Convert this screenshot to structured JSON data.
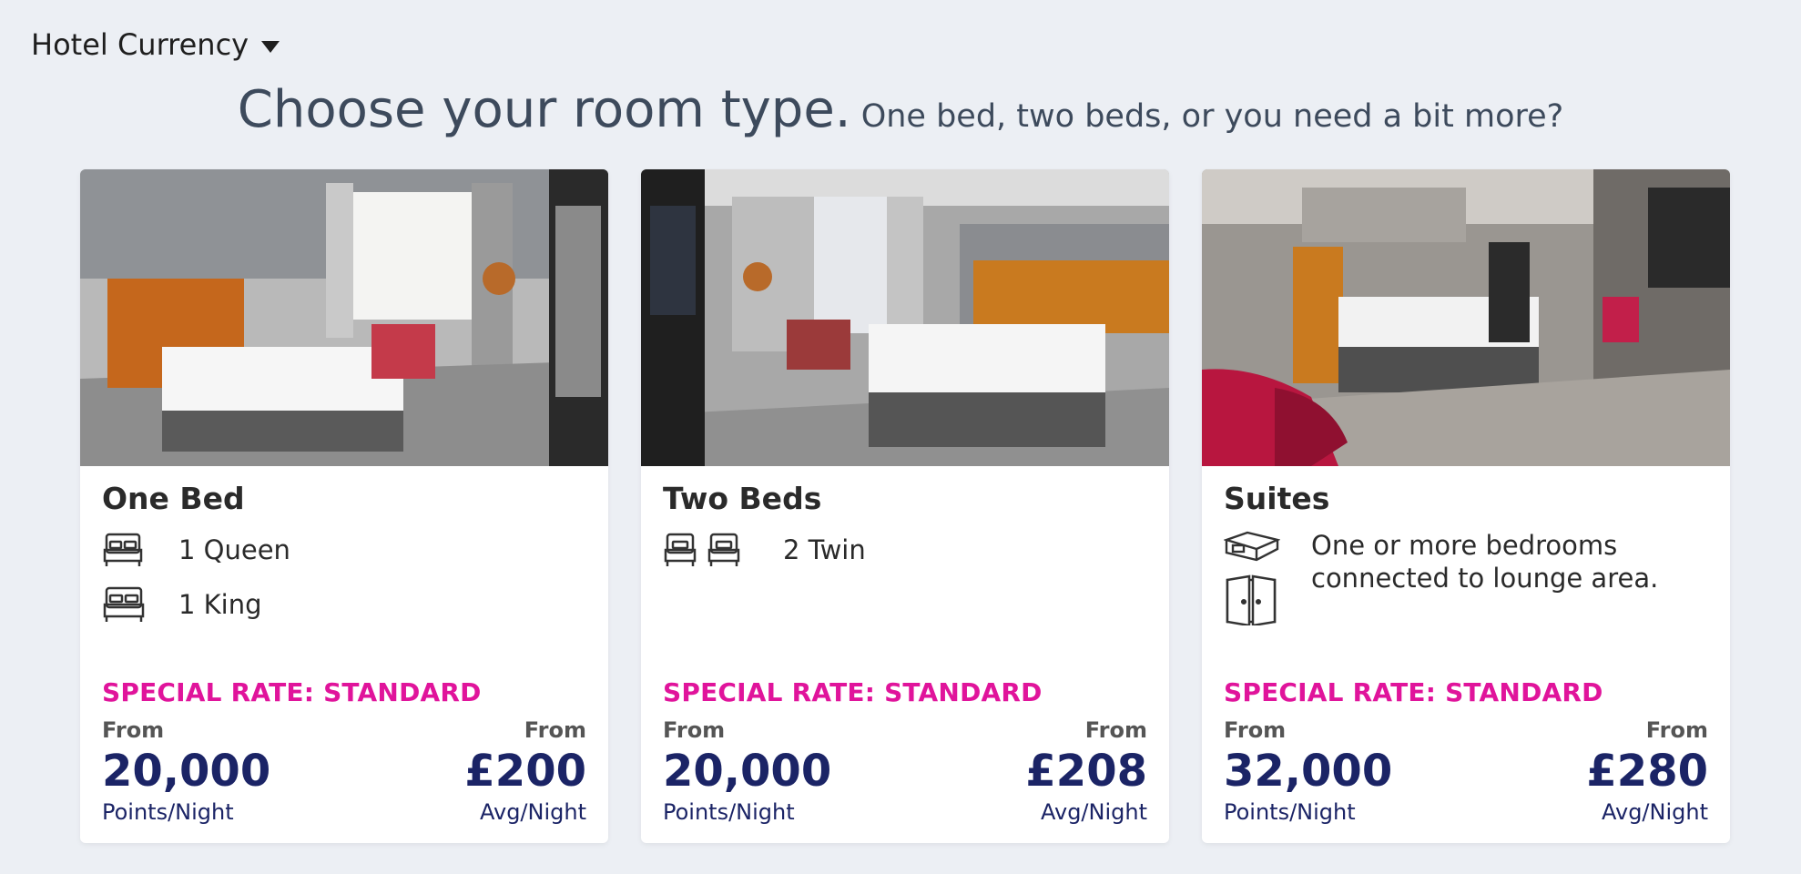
{
  "header": {
    "currency_label": "Hotel Currency",
    "title": "Choose your room type.",
    "subtitle": "One bed, two beds, or you need a bit more?"
  },
  "colors": {
    "accent": "#e0149b",
    "price": "#1b2466",
    "heading": "#3d4a5c",
    "background": "#eceff4"
  },
  "cards": [
    {
      "title": "One Bed",
      "beds": [
        {
          "icon": "bed-icon",
          "label": "1 Queen"
        },
        {
          "icon": "bed-icon",
          "label": "1 King"
        }
      ],
      "rate": "SPECIAL RATE: STANDARD",
      "points_from": "From",
      "points": "20,000",
      "points_unit": "Points/Night",
      "cash_from": "From",
      "cash": "£200",
      "cash_unit": "Avg/Night"
    },
    {
      "title": "Two Beds",
      "beds": [
        {
          "icon": "twin-bed-icon",
          "label": "2 Twin"
        }
      ],
      "rate": "SPECIAL RATE: STANDARD",
      "points_from": "From",
      "points": "20,000",
      "points_unit": "Points/Night",
      "cash_from": "From",
      "cash": "£208",
      "cash_unit": "Avg/Night"
    },
    {
      "title": "Suites",
      "description": "One or more bedrooms connected to lounge area.",
      "icons": [
        "sofa-bed-icon",
        "door-icon"
      ],
      "rate": "SPECIAL RATE: STANDARD",
      "points_from": "From",
      "points": "32,000",
      "points_unit": "Points/Night",
      "cash_from": "From",
      "cash": "£280",
      "cash_unit": "Avg/Night"
    }
  ]
}
